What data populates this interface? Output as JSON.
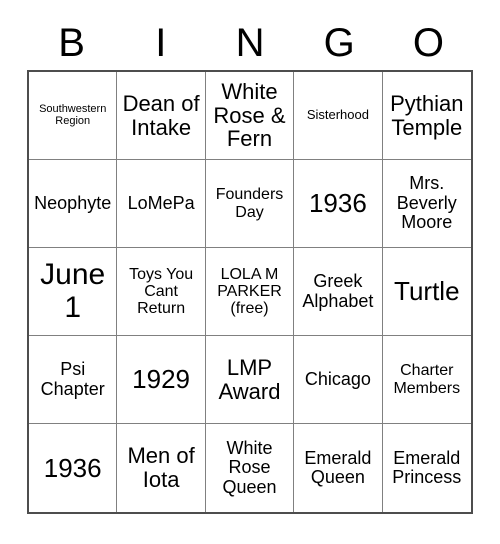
{
  "card": {
    "header": {
      "letters": [
        "B",
        "I",
        "N",
        "G",
        "O"
      ]
    },
    "rows": [
      [
        {
          "text": "Southwestern Region",
          "size": "xxs"
        },
        {
          "text": "Dean of Intake",
          "size": "l"
        },
        {
          "text": "White Rose & Fern",
          "size": "l"
        },
        {
          "text": "Sisterhood",
          "size": "xs"
        },
        {
          "text": "Pythian Temple",
          "size": "l"
        }
      ],
      [
        {
          "text": "Neophyte",
          "size": "m"
        },
        {
          "text": "LoMePa",
          "size": "m"
        },
        {
          "text": "Founders Day",
          "size": "s"
        },
        {
          "text": "1936",
          "size": "xl"
        },
        {
          "text": "Mrs. Beverly Moore",
          "size": "m"
        }
      ],
      [
        {
          "text": "June 1",
          "size": "xxl"
        },
        {
          "text": "Toys You Cant Return",
          "size": "s"
        },
        {
          "text": "LOLA M PARKER (free)",
          "size": "s"
        },
        {
          "text": "Greek Alphabet",
          "size": "m"
        },
        {
          "text": "Turtle",
          "size": "xl"
        }
      ],
      [
        {
          "text": "Psi Chapter",
          "size": "m"
        },
        {
          "text": "1929",
          "size": "xl"
        },
        {
          "text": "LMP Award",
          "size": "l"
        },
        {
          "text": "Chicago",
          "size": "m"
        },
        {
          "text": "Charter Members",
          "size": "s"
        }
      ],
      [
        {
          "text": "1936",
          "size": "xl"
        },
        {
          "text": "Men of Iota",
          "size": "l"
        },
        {
          "text": "White Rose Queen",
          "size": "m"
        },
        {
          "text": "Emerald Queen",
          "size": "m"
        },
        {
          "text": "Emerald Princess",
          "size": "m"
        }
      ]
    ],
    "colors": {
      "background": "#ffffff",
      "text": "#000000",
      "grid_line": "#808080",
      "grid_outline": "#4d4d4d"
    }
  }
}
